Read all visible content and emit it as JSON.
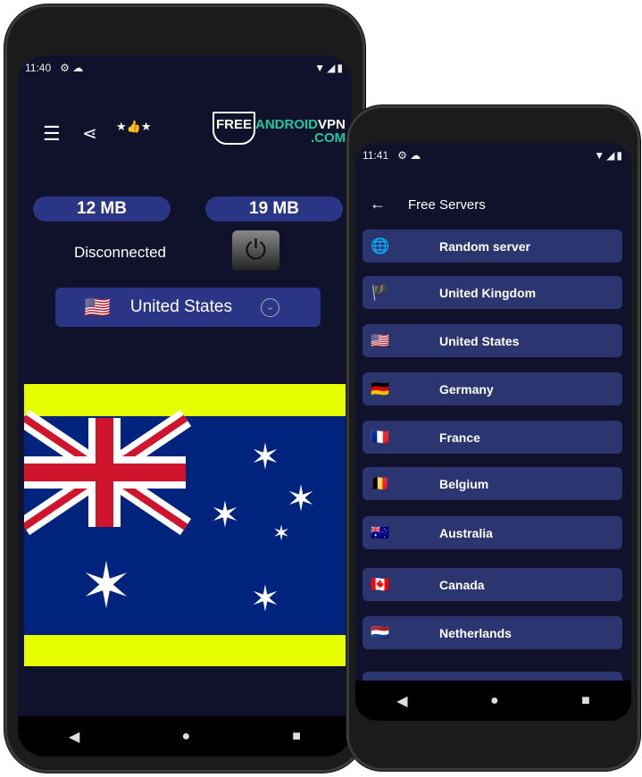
{
  "left": {
    "status": {
      "time": "11:40"
    },
    "logo": "FREEANDROIDVPN.COM",
    "download": "12 MB",
    "upload": "19 MB",
    "state": "Disconnected",
    "country": {
      "flag": "🇺🇸",
      "name": "United States"
    },
    "nav": [
      "◀",
      "●",
      "■"
    ]
  },
  "right": {
    "status": {
      "time": "11:41"
    },
    "title": "Free Servers",
    "servers": [
      {
        "icon": "🌐",
        "name": "Random server"
      },
      {
        "icon": "🏴",
        "name": "United Kingdom"
      },
      {
        "icon": "🇺🇸",
        "name": "United States"
      },
      {
        "icon": "🇩🇪",
        "name": "Germany"
      },
      {
        "icon": "🇫🇷",
        "name": "France"
      },
      {
        "icon": "🇧🇪",
        "name": "Belgium"
      },
      {
        "icon": "🇦🇺",
        "name": "Australia"
      },
      {
        "icon": "🇨🇦",
        "name": "Canada"
      },
      {
        "icon": "🇳🇱",
        "name": "Netherlands"
      }
    ],
    "nav": [
      "◀",
      "●",
      "■"
    ]
  },
  "colors": {
    "bg": "#10122b",
    "accent": "#2b3585",
    "flag_band": "#e5ff00"
  }
}
